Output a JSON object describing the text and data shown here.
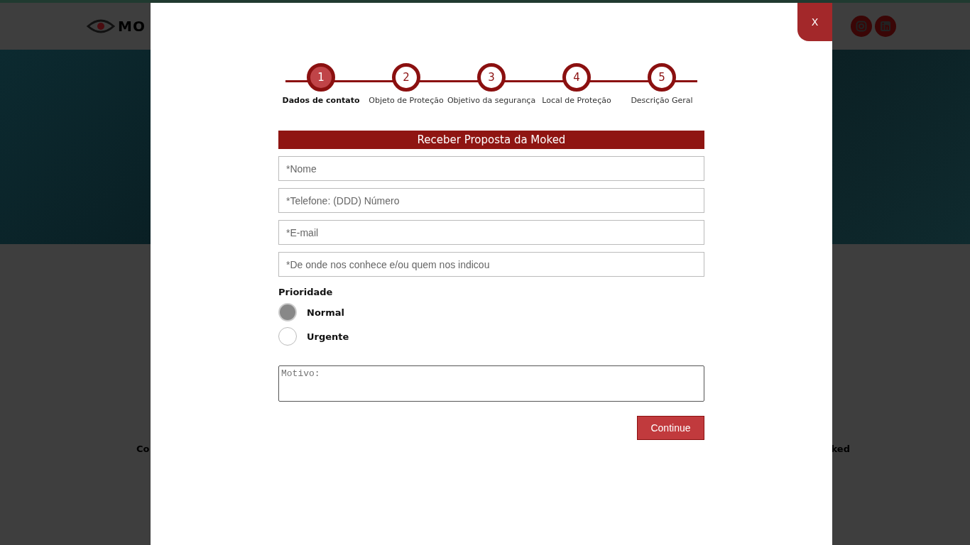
{
  "header": {
    "logo_text": "MO"
  },
  "background_texts": [
    "Co",
    "ked"
  ],
  "modal": {
    "close": "X",
    "steps": [
      {
        "number": "1",
        "label": "Dados de contato",
        "selected": true
      },
      {
        "number": "2",
        "label": "Objeto de Proteção",
        "selected": false
      },
      {
        "number": "3",
        "label": "Objetivo da segurança",
        "selected": false
      },
      {
        "number": "4",
        "label": "Local de Proteção",
        "selected": false
      },
      {
        "number": "5",
        "label": "Descrição Geral",
        "selected": false
      }
    ],
    "form_title": "Receber Proposta da Moked",
    "fields": [
      {
        "placeholder": "*Nome"
      },
      {
        "placeholder": "*Telefone: (DDD) Número"
      },
      {
        "placeholder": "*E-mail"
      },
      {
        "placeholder": "*De onde nos conhece e/ou quem nos indicou"
      }
    ],
    "priority": {
      "label": "Prioridade",
      "options": [
        {
          "label": "Normal",
          "selected": true
        },
        {
          "label": "Urgente",
          "selected": false
        }
      ]
    },
    "reason": {
      "placeholder": "Motivo:"
    },
    "submit": "Continue"
  }
}
